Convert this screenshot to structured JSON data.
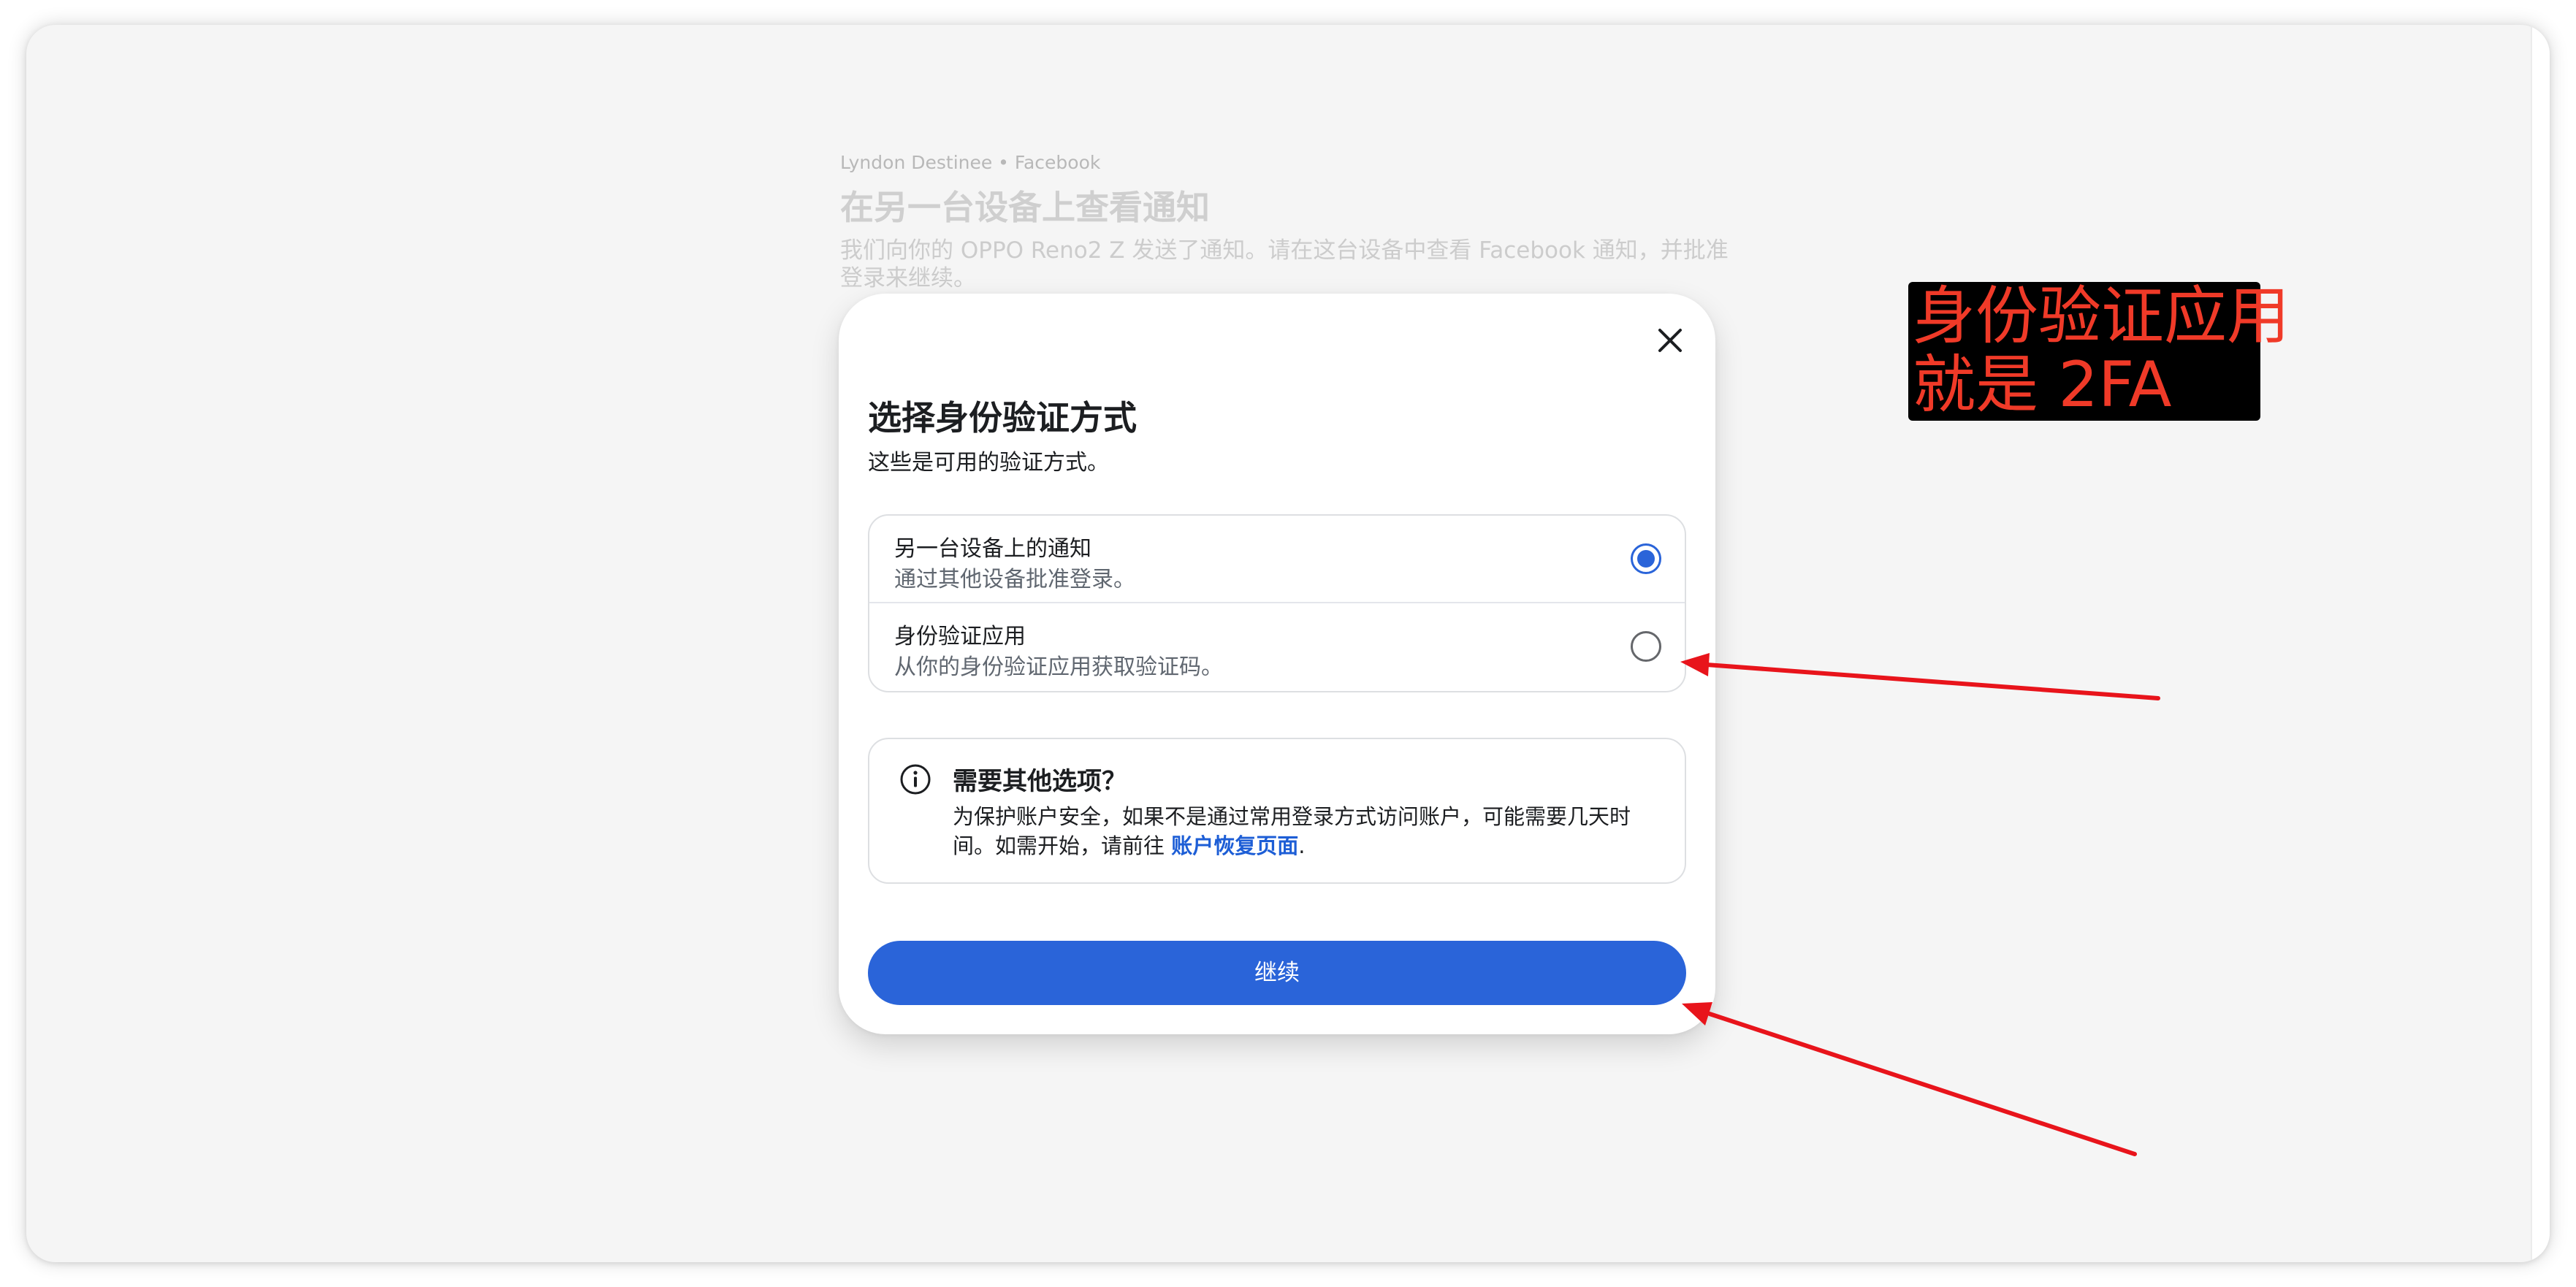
{
  "background": {
    "meta": "Lyndon Destinee • Facebook",
    "title": "在另一台设备上查看通知",
    "description": "我们向你的 OPPO Reno2 Z 发送了通知。请在这台设备中查看 Facebook 通知，并批准登录来继续。"
  },
  "modal": {
    "close_icon": "close-icon",
    "title": "选择身份验证方式",
    "subtitle": "这些是可用的验证方式。",
    "options": [
      {
        "title": "另一台设备上的通知",
        "subtitle": "通过其他设备批准登录。",
        "selected": true
      },
      {
        "title": "身份验证应用",
        "subtitle": "从你的身份验证应用获取验证码。",
        "selected": false
      }
    ],
    "info": {
      "icon": "info-icon",
      "title": "需要其他选项？",
      "text": "为保护账户安全，如果不是通过常用登录方式访问账户，可能需要几天时间。如需开始，请前往 ",
      "link": "账户恢复页面",
      "text_end": "."
    },
    "continue_label": "继续"
  },
  "annotation": {
    "text": "身份验证应用\n就是 2FA",
    "color": "#f03a28"
  },
  "colors": {
    "primary": "#2a64d9",
    "link": "#1d5ed6",
    "annotation_arrow": "#e8141b"
  }
}
